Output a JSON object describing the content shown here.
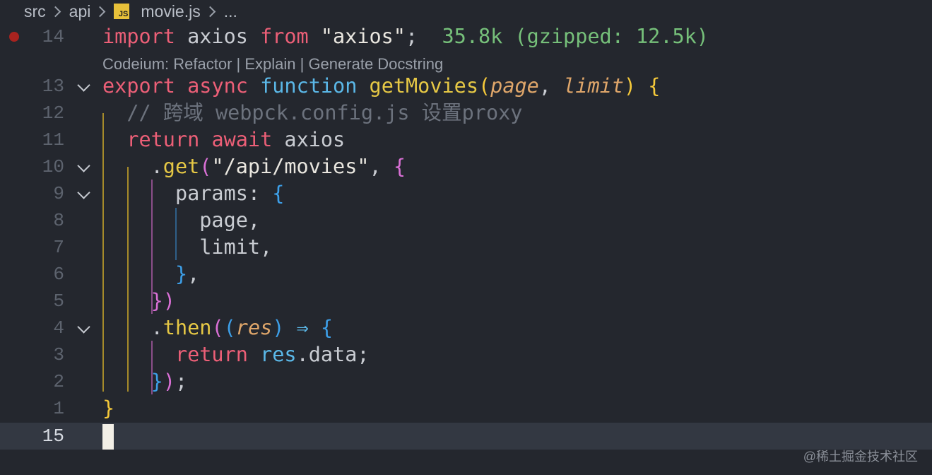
{
  "breadcrumb": {
    "items": [
      "src",
      "api"
    ],
    "file_badge": "JS",
    "file": "movie.js",
    "ellipsis": "..."
  },
  "codelens": "Codeium: Refactor | Explain | Generate Docstring",
  "lines": {
    "l14": {
      "num": "14",
      "tokens": [
        {
          "t": "import",
          "c": "kw"
        },
        {
          "t": " axios ",
          "c": "plain"
        },
        {
          "t": "from",
          "c": "kw"
        },
        {
          "t": " \"axios\"",
          "c": "str"
        },
        {
          "t": ";",
          "c": "plain"
        },
        {
          "t": "  35.8k (gzipped: 12.5k)",
          "c": "size"
        }
      ]
    },
    "l13": {
      "num": "13",
      "tokens": [
        {
          "t": "export",
          "c": "kw"
        },
        {
          "t": " ",
          "c": "plain"
        },
        {
          "t": "async",
          "c": "kw"
        },
        {
          "t": " ",
          "c": "plain"
        },
        {
          "t": "function",
          "c": "def"
        },
        {
          "t": " ",
          "c": "plain"
        },
        {
          "t": "getMovies",
          "c": "fn"
        },
        {
          "t": "(",
          "c": "b1"
        },
        {
          "t": "page",
          "c": "param"
        },
        {
          "t": ", ",
          "c": "plain"
        },
        {
          "t": "limit",
          "c": "param"
        },
        {
          "t": ") ",
          "c": "b1"
        },
        {
          "t": "{",
          "c": "b1"
        }
      ]
    },
    "l12": {
      "num": "12",
      "tokens": [
        {
          "t": "  // 跨域 webpck.config.js 设置proxy",
          "c": "cm"
        }
      ]
    },
    "l11": {
      "num": "11",
      "tokens": [
        {
          "t": "  ",
          "c": "plain"
        },
        {
          "t": "return",
          "c": "kw"
        },
        {
          "t": " ",
          "c": "plain"
        },
        {
          "t": "await",
          "c": "kw"
        },
        {
          "t": " axios",
          "c": "plain"
        }
      ]
    },
    "l10": {
      "num": "10",
      "tokens": [
        {
          "t": "    .",
          "c": "plain"
        },
        {
          "t": "get",
          "c": "fn"
        },
        {
          "t": "(",
          "c": "b2"
        },
        {
          "t": "\"/api/movies\"",
          "c": "str"
        },
        {
          "t": ", ",
          "c": "plain"
        },
        {
          "t": "{",
          "c": "b2"
        }
      ]
    },
    "l9": {
      "num": "9",
      "tokens": [
        {
          "t": "      params: ",
          "c": "plain"
        },
        {
          "t": "{",
          "c": "b3"
        }
      ]
    },
    "l8": {
      "num": "8",
      "tokens": [
        {
          "t": "        page,",
          "c": "plain"
        }
      ]
    },
    "l7": {
      "num": "7",
      "tokens": [
        {
          "t": "        limit,",
          "c": "plain"
        }
      ]
    },
    "l6": {
      "num": "6",
      "tokens": [
        {
          "t": "      ",
          "c": "plain"
        },
        {
          "t": "}",
          "c": "b3"
        },
        {
          "t": ",",
          "c": "plain"
        }
      ]
    },
    "l5": {
      "num": "5",
      "tokens": [
        {
          "t": "    ",
          "c": "plain"
        },
        {
          "t": "})",
          "c": "b2"
        }
      ]
    },
    "l4": {
      "num": "4",
      "tokens": [
        {
          "t": "    .",
          "c": "plain"
        },
        {
          "t": "then",
          "c": "fn"
        },
        {
          "t": "(",
          "c": "b2"
        },
        {
          "t": "(",
          "c": "b3"
        },
        {
          "t": "res",
          "c": "param"
        },
        {
          "t": ")",
          "c": "b3"
        },
        {
          "t": " ⇒ ",
          "c": "def"
        },
        {
          "t": "{",
          "c": "b3"
        }
      ]
    },
    "l3": {
      "num": "3",
      "tokens": [
        {
          "t": "      ",
          "c": "plain"
        },
        {
          "t": "return",
          "c": "kw"
        },
        {
          "t": " ",
          "c": "plain"
        },
        {
          "t": "res",
          "c": "obj"
        },
        {
          "t": ".data;",
          "c": "plain"
        }
      ]
    },
    "l2": {
      "num": "2",
      "tokens": [
        {
          "t": "    ",
          "c": "plain"
        },
        {
          "t": "}",
          "c": "b3"
        },
        {
          "t": ")",
          "c": "b2"
        },
        {
          "t": ";",
          "c": "plain"
        }
      ]
    },
    "l1": {
      "num": "1",
      "tokens": [
        {
          "t": "}",
          "c": "b1"
        }
      ]
    },
    "l15": {
      "num": "15",
      "tokens": []
    }
  },
  "colors": {
    "background": "#24272e",
    "current_line": "#333842",
    "keyword": "#ec5f77",
    "function": "#e6c845",
    "comment": "#6c727d",
    "import_size": "#76c07a",
    "breakpoint": "#a8231f",
    "guide_1": "#a58a2a",
    "guide_2": "#8b4f8a",
    "guide_3": "#2f5f88"
  },
  "watermark": "@稀土掘金技术社区"
}
